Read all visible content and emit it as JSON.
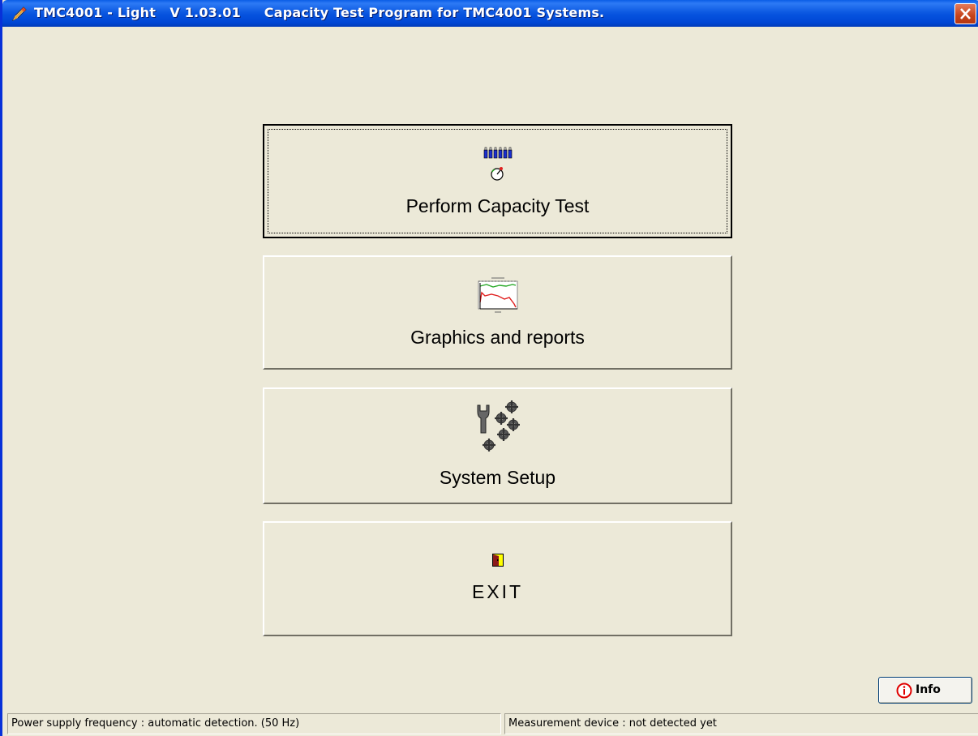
{
  "window": {
    "title": "TMC4001 - Light   V 1.03.01     Capacity Test Program for TMC4001 Systems.",
    "close_icon": "close-x-icon",
    "app_icon": "pencil-app-icon"
  },
  "menu": {
    "buttons": [
      {
        "label": "Perform Capacity Test",
        "icon": "battery-gauge-icon",
        "focused": true
      },
      {
        "label": "Graphics and reports",
        "icon": "chart-icon",
        "focused": false
      },
      {
        "label": "System Setup",
        "icon": "wrench-gears-icon",
        "focused": false
      },
      {
        "label": "EXIT",
        "icon": "door-exit-icon",
        "focused": false
      }
    ]
  },
  "info_button": {
    "label": "Info",
    "icon": "info-icon"
  },
  "statusbar": {
    "left": "Power supply frequency : automatic detection. (50 Hz)",
    "right": "Measurement device : not detected yet"
  },
  "colors": {
    "titlebar": "#0a5de6",
    "background": "#ece9d8",
    "close_button": "#c5431b",
    "info_icon": "#e00000"
  }
}
